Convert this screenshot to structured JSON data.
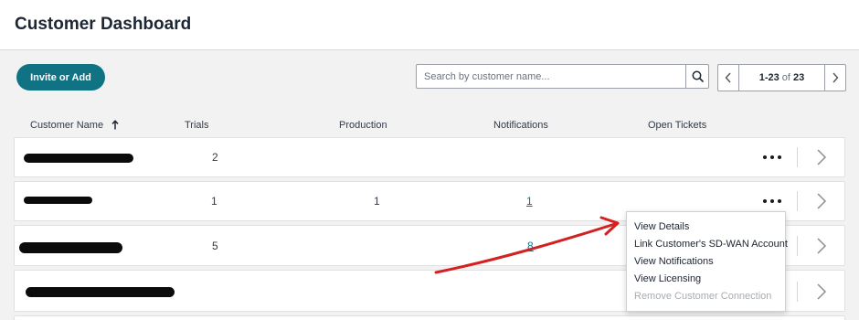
{
  "header": {
    "title": "Customer Dashboard"
  },
  "toolbar": {
    "invite_label": "Invite or Add",
    "search_placeholder": "Search by customer name...",
    "pager": {
      "range": "1-23",
      "of": "of",
      "total": "23"
    }
  },
  "table": {
    "columns": {
      "name": "Customer Name",
      "trials": "Trials",
      "production": "Production",
      "notifications": "Notifications",
      "tickets": "Open Tickets"
    },
    "rows": [
      {
        "trials": "2",
        "production": "",
        "notifications": ""
      },
      {
        "trials": "1",
        "production": "1",
        "notifications": "1"
      },
      {
        "trials": "5",
        "production": "",
        "notifications": "8"
      },
      {
        "trials": "",
        "production": "",
        "notifications": ""
      }
    ]
  },
  "menu": {
    "items": [
      {
        "label": "View Details",
        "enabled": true
      },
      {
        "label": "Link Customer's SD-WAN Account",
        "enabled": true
      },
      {
        "label": "View Notifications",
        "enabled": true
      },
      {
        "label": "View Licensing",
        "enabled": true
      },
      {
        "label": "Remove Customer Connection",
        "enabled": false
      }
    ]
  },
  "colors": {
    "accent": "#0f7384",
    "annotation": "#d42020",
    "page_bg": "#f2f2f2"
  },
  "icons": [
    "search-icon",
    "chevron-left-icon",
    "chevron-right-icon",
    "sort-up-icon",
    "more-dots-icon"
  ]
}
